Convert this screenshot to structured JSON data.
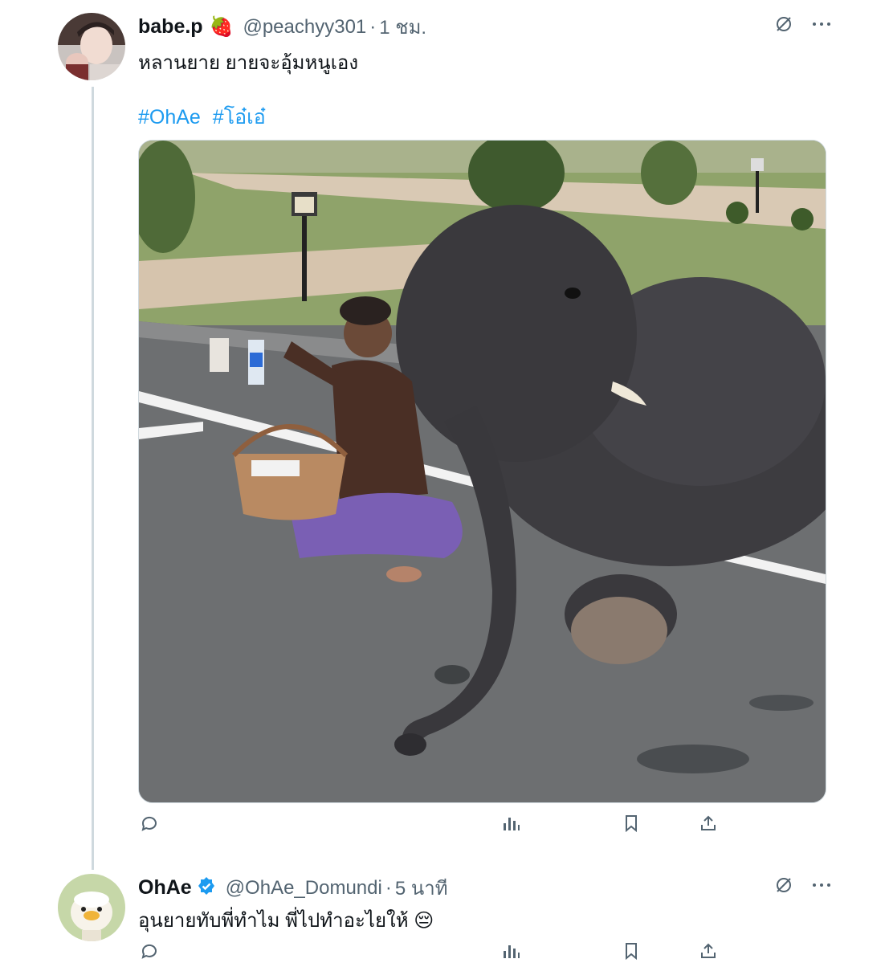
{
  "tweet": {
    "display_name": "babe.p",
    "name_emoji": "🍓",
    "handle": "@peachyy301",
    "separator": "·",
    "time": "1 ชม.",
    "text": "หลานยาย ยายจะอุ้มหนูเอง",
    "hashtags": [
      "#OhAe",
      "#โอ๋เอ๋"
    ],
    "media_icon": "photo-elephant-with-woman",
    "icons": [
      "grok-icon",
      "more-icon",
      "reply-icon",
      "views-icon",
      "bookmark-icon",
      "share-icon"
    ]
  },
  "reply": {
    "display_name": "OhAe",
    "verified": true,
    "handle": "@OhAe_Domundi",
    "separator": "·",
    "time": "5 นาที",
    "text": "อุนยายทับพี่ทำไม พี่ไปทำอะไยให้ 😔",
    "icons": [
      "grok-icon",
      "more-icon",
      "reply-icon",
      "views-icon",
      "bookmark-icon",
      "share-icon"
    ]
  },
  "colors": {
    "link": "#1d9bf0",
    "secondary_text": "#536471",
    "thread_line": "#cfd9de",
    "verified": "#1d9bf0"
  }
}
